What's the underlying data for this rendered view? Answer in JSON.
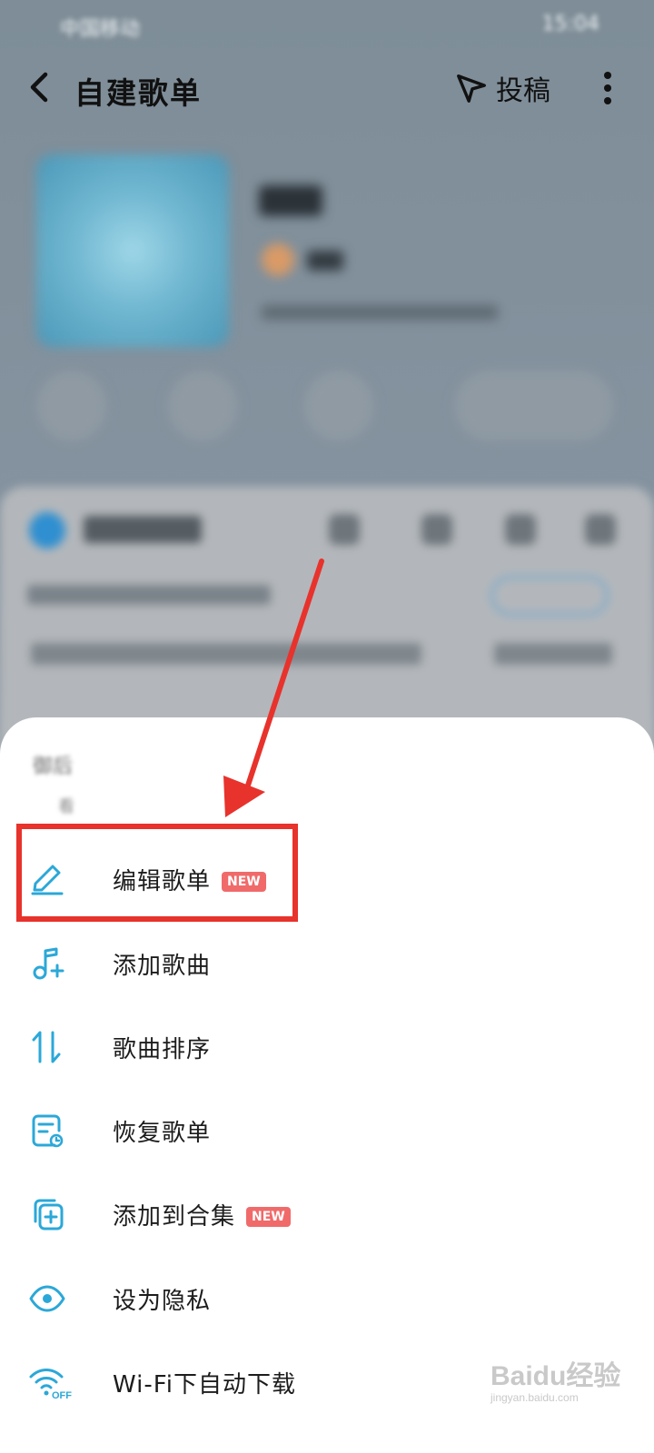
{
  "status_bar": {
    "carrier": "中国移动",
    "time": "15:04"
  },
  "nav": {
    "title": "自建歌单",
    "submit_label": "投稿"
  },
  "playlist": {
    "name": "御姐",
    "user": "飞鸟",
    "description": "快来给你的歌单添加一段描述吧",
    "collect_label": "收藏"
  },
  "list_header": {
    "play_all": "播放全部",
    "sub_text": "小贴士：歌单描述",
    "chip": "去添加",
    "notice": "官方推荐：歌单中有无法播放的歌曲",
    "notice_right": "立即查看"
  },
  "sheet": {
    "title": "御后",
    "subtitle": "看",
    "items": [
      {
        "label": "编辑歌单",
        "badge": "NEW",
        "icon": "pencil-icon"
      },
      {
        "label": "添加歌曲",
        "badge": "",
        "icon": "music-note-add-icon"
      },
      {
        "label": "歌曲排序",
        "badge": "",
        "icon": "sort-arrows-icon"
      },
      {
        "label": "恢复歌单",
        "badge": "",
        "icon": "restore-list-icon"
      },
      {
        "label": "添加到合集",
        "badge": "NEW",
        "icon": "add-to-collection-icon"
      },
      {
        "label": "设为隐私",
        "badge": "",
        "icon": "eye-icon"
      },
      {
        "label": "Wi-Fi下自动下载",
        "badge": "",
        "icon": "wifi-off-icon"
      }
    ]
  },
  "watermark": {
    "logo": "Baidu经验",
    "url": "jingyan.baidu.com"
  },
  "colors": {
    "accent": "#2ba8d8",
    "badge": "#f06a6a",
    "annotation": "#e8322c"
  }
}
